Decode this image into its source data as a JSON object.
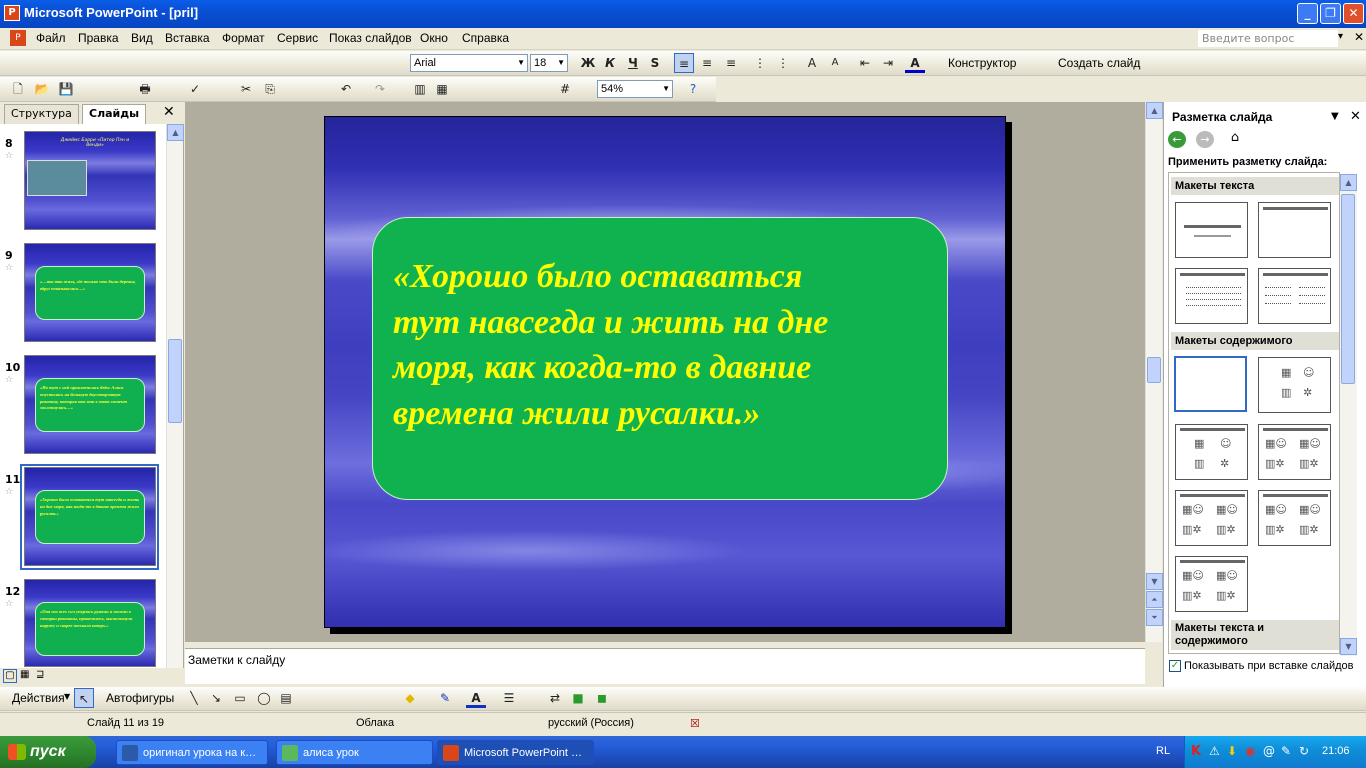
{
  "window": {
    "title": "Microsoft PowerPoint - [pril]"
  },
  "menu": [
    "Файл",
    "Правка",
    "Вид",
    "Вставка",
    "Формат",
    "Сервис",
    "Показ слайдов",
    "Окно",
    "Справка"
  ],
  "ask_placeholder": "Введите вопрос",
  "format_toolbar": {
    "font": "Arial",
    "size": "18",
    "bold": "Ж",
    "italic": "К",
    "underline": "Ч",
    "shadow": "S",
    "designer": "Конструктор",
    "new_slide": "Создать слайд"
  },
  "standard_toolbar": {
    "zoom": "54%"
  },
  "tabs": {
    "outline": "Структура",
    "slides": "Слайды"
  },
  "thumbnails": [
    {
      "num": "8",
      "text": "Джеймс Барри «Питер Пэн и Венди»"
    },
    {
      "num": "9",
      "text": "«…ты так жаль, где только что были деревья, вдруг показывались…»"
    },
    {
      "num": "10",
      "text": "«Но тут с ней приключилась беда: Алиса опустилась на большую двустворчатую раковину, которая вот вот в этот момент захлопнулась…»"
    },
    {
      "num": "11",
      "text": "«Хорошо было оставаться тут навсегда и жить на дне моря, как когда-то в давние времена жили русалки.»"
    },
    {
      "num": "12",
      "text": "«Она изо всех сил уперлась руками и ногами в створки раковины, прокачалась, выскользнула наружу и скорее поплыла наверх.»"
    }
  ],
  "slide": {
    "quote_lines": [
      "«Хорошо было оставаться",
      "тут навсегда и жить на дне",
      "моря, как когда-то в давние",
      "времена жили русалки.»"
    ],
    "bg_color": "#3030b4",
    "box_color": "#0fb24e",
    "text_color": "#ffff00"
  },
  "notes_placeholder": "Заметки к слайду",
  "taskpane": {
    "title": "Разметка слайда",
    "apply_label": "Применить разметку слайда:",
    "sections": [
      "Макеты текста",
      "Макеты содержимого",
      "Макеты текста и содержимого"
    ],
    "show_on_insert": "Показывать при вставке слайдов"
  },
  "draw_toolbar": {
    "actions": "Действия",
    "autoshapes": "Автофигуры"
  },
  "status": {
    "slide": "Слайд 11 из 19",
    "design": "Облака",
    "language": "русский (Россия)"
  },
  "taskbar": {
    "start": "пуск",
    "tasks": [
      "оригинал урока на к…",
      "алиса урок",
      "Microsoft PowerPoint …"
    ],
    "lang": "RL",
    "clock": "21:06"
  }
}
